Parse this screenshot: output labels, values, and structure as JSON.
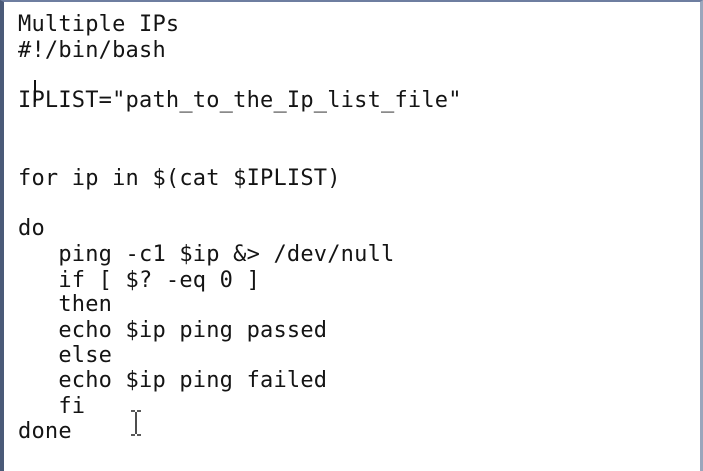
{
  "editor": {
    "lines": [
      "Multiple IPs",
      "#!/bin/bash",
      "",
      "IPLIST=\"path_to_the_Ip_list_file\"",
      "",
      "",
      "for ip in $(cat $IPLIST)",
      "",
      "do",
      "   ping -c1 $ip &> /dev/null",
      "   if [ $? -eq 0 ]",
      "   then",
      "   echo $ip ping passed",
      "   else",
      "   echo $ip ping failed",
      "   fi",
      "done"
    ]
  },
  "colors": {
    "text": "#141414",
    "background": "#ffffff",
    "frame_border": "#4a5a78"
  },
  "icons": {
    "text_cursor": "i-beam-cursor-icon",
    "caret": "text-caret"
  }
}
